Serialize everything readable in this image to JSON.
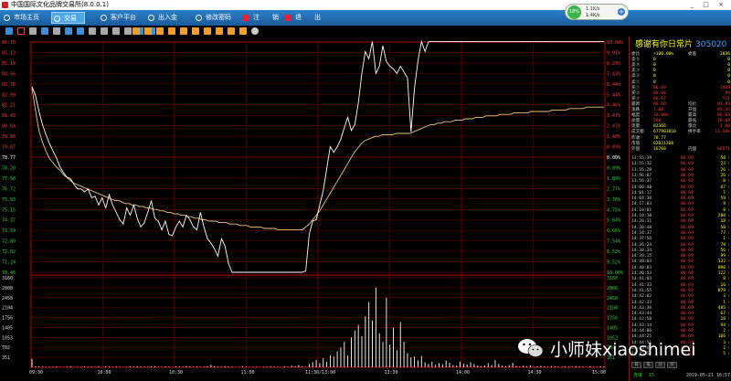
{
  "app": {
    "title": "中国国际文化品牌交易所(8.0.0.1)",
    "window_controls": "_ □ ×"
  },
  "menu": [
    {
      "label": "市场主页",
      "icon": "home-icon",
      "active": false
    },
    {
      "label": "交易",
      "icon": "trade-icon",
      "active": true
    },
    {
      "label": "客户平台",
      "icon": "customer-icon",
      "active": false
    },
    {
      "label": "出入金",
      "icon": "money-icon",
      "active": false
    },
    {
      "label": "修改密码",
      "icon": "key-icon",
      "active": false
    },
    {
      "label": "注　　销",
      "icon": "logout-icon",
      "active": false,
      "danger": true
    },
    {
      "label": "退　　出",
      "icon": "exit-icon",
      "active": false,
      "danger": true
    }
  ],
  "net": {
    "percent": "18%",
    "up": "1.1K/s",
    "down": "1.4K/s"
  },
  "toolbar_icons": [
    "chart-icon",
    "pen-icon",
    "print-icon",
    "save-icon",
    "copy-icon",
    "zoom-in-icon",
    "zoom-out-icon",
    "left-icon",
    "right-icon",
    "up-icon",
    "down-icon",
    "list-icon",
    "grid-icon",
    "k-icon",
    "f-icon",
    "b-icon",
    "s-icon",
    "m-icon",
    "n-icon",
    "t-icon",
    "x-icon",
    "y-icon",
    "z-icon",
    "gear-icon"
  ],
  "stock": {
    "name": "感谢有你日常片",
    "code": "305020"
  },
  "quote_rows": [
    {
      "l": "委比",
      "v": "+100.00%",
      "l2": "委差",
      "v2": "2036"
    },
    {
      "l": "卖⑤",
      "v": "0",
      "v2": "0"
    },
    {
      "l": "卖④",
      "v": "0",
      "v2": "0"
    },
    {
      "l": "卖③",
      "v": "0",
      "v2": "0"
    },
    {
      "l": "卖②",
      "v": "0",
      "v2": "0"
    },
    {
      "l": "卖①",
      "v": "0",
      "v2": "0"
    },
    {
      "l": "买①",
      "v": "86.69",
      "v2": "1409"
    },
    {
      "l": "买②",
      "v": "86.68",
      "v2": "99"
    },
    {
      "l": "买③",
      "v": "86.67",
      "v2": "511"
    },
    {
      "l": "最新",
      "v": "86.69",
      "l2": "均价",
      "v2": "81.93"
    },
    {
      "l": "涨跌",
      "v": "7.88",
      "l2": "开盘",
      "v2": "83.35"
    },
    {
      "l": "幅度",
      "v": "10.00%",
      "l2": "最高",
      "v2": "86.69"
    },
    {
      "l": "总量",
      "v": "590",
      "l2": "最低",
      "v2": "70.08"
    },
    {
      "l": "现量",
      "v": "82366",
      "l2": "量比",
      "v2": "1.00"
    },
    {
      "l": "成交额",
      "v": "677903810",
      "l2": "换手率",
      "v2": "11.50%"
    },
    {
      "l": "昨收",
      "v": "78.77",
      "v2": ""
    },
    {
      "l": "市值",
      "v": "62821260",
      "v2": ""
    },
    {
      "l": "外盘",
      "v": "16768",
      "l2": "内盘",
      "v2": "66571"
    }
  ],
  "ticks": [
    {
      "t": "13:55:39",
      "p": "86.69",
      "v": "58",
      "d": "↑"
    },
    {
      "t": "13:55:32",
      "p": "86.69",
      "v": "23",
      "d": "↑"
    },
    {
      "t": "13:55:28",
      "p": "86.69",
      "v": "26",
      "d": "↑"
    },
    {
      "t": "13:56:07",
      "p": "86.69",
      "v": "26",
      "d": "↑"
    },
    {
      "t": "13:56:37",
      "p": "86.69",
      "v": "8",
      "d": "↑"
    },
    {
      "t": "14:00:48",
      "p": "86.69",
      "v": "67",
      "d": "↑"
    },
    {
      "t": "14:01:17",
      "p": "86.69",
      "v": "1",
      "d": "↑"
    },
    {
      "t": "14:04:30",
      "p": "86.69",
      "v": "59",
      "d": "↑"
    },
    {
      "t": "14:17:03",
      "p": "86.69",
      "v": "9",
      "d": "↑"
    },
    {
      "t": "14:10:01",
      "p": "86.69",
      "v": "8",
      "d": "↑"
    },
    {
      "t": "14:10:10",
      "p": "86.69",
      "v": "288",
      "d": "↑"
    },
    {
      "t": "14:20:31",
      "p": "86.69",
      "v": "18",
      "d": "↑"
    },
    {
      "t": "14:30:48",
      "p": "86.69",
      "v": "50",
      "d": "↑"
    },
    {
      "t": "14:34:37",
      "p": "86.69",
      "v": "77",
      "d": "↑"
    },
    {
      "t": "14:37:56",
      "p": "86.69",
      "v": "1",
      "d": "↑"
    },
    {
      "t": "14:36:24",
      "p": "86.69",
      "v": "78",
      "d": "↑"
    },
    {
      "t": "14:38:34",
      "p": "86.69",
      "v": "56",
      "d": "↑"
    },
    {
      "t": "14:39:15",
      "p": "86.69",
      "v": "99",
      "d": "↑"
    },
    {
      "t": "14:40:03",
      "p": "86.69",
      "v": "132",
      "d": "↑"
    },
    {
      "t": "14:40:03",
      "p": "86.69",
      "v": "890",
      "d": "↑"
    },
    {
      "t": "14:40:53",
      "p": "86.69",
      "v": "122",
      "d": "↑"
    },
    {
      "t": "14:41:03",
      "p": "86.69",
      "v": "8",
      "d": "↑"
    },
    {
      "t": "14:41:33",
      "p": "86.69",
      "v": "16",
      "d": "↑"
    },
    {
      "t": "14:41:55",
      "p": "86.69",
      "v": "879",
      "d": "↑"
    },
    {
      "t": "14:42:02",
      "p": "86.69",
      "v": "3",
      "d": "↑"
    },
    {
      "t": "14:42:33",
      "p": "86.69",
      "v": "1",
      "d": "↑"
    },
    {
      "t": "14:43:36",
      "p": "86.69",
      "v": "485",
      "d": "↑"
    },
    {
      "t": "14:43:44",
      "p": "86.69",
      "v": "67",
      "d": "↑"
    },
    {
      "t": "14:43:58",
      "p": "86.69",
      "v": "18",
      "d": "↑"
    },
    {
      "t": "14:43:14",
      "p": "86.69",
      "v": "94",
      "d": "↑"
    },
    {
      "t": "14:44:06",
      "p": "86.69",
      "v": "2",
      "d": "↑"
    },
    {
      "t": "14:44:25",
      "p": "86.69",
      "v": "166",
      "d": "↑"
    },
    {
      "t": "14:44:51",
      "p": "86.69",
      "v": "3",
      "d": "↑"
    },
    {
      "t": "14:45:02",
      "p": "86.69",
      "v": "2",
      "d": "↑"
    },
    {
      "t": "14:45:53",
      "p": "86.69",
      "v": "5",
      "d": "↑"
    }
  ],
  "panel_tabs": [
    "日",
    "笔",
    "分",
    "价"
  ],
  "status": {
    "connected": "连接",
    "count": "15",
    "datetime": "2019-05-21 16:57"
  },
  "watermark": "小师妹xiaoshimei",
  "colors": {
    "up": "#ff3b3b",
    "down": "#33d633",
    "flat": "#ffffff",
    "grid": "#7a0000",
    "avg": "#e8c87a",
    "volume": "#ffffff"
  },
  "chart_data": {
    "type": "line",
    "title": "",
    "xlabel": "",
    "ylabel": "",
    "prev_close": 78.77,
    "ylim": [
      70.9,
      86.65
    ],
    "price_ticks": [
      "86.70",
      "85.13",
      "85.14",
      "84.56",
      "83.78",
      "82.99",
      "82.21",
      "81.43",
      "80.64",
      "79.86",
      "79.07",
      "78.77",
      "78.20",
      "77.50",
      "76.72",
      "75.93",
      "75.15",
      "74.37",
      "73.59",
      "72.80",
      "72.02",
      "71.24",
      "70.46"
    ],
    "pct_ticks": [
      "10.00%",
      "9.07%",
      "8.29%",
      "7.43%",
      "6.44%",
      "5.44%",
      "4.46%",
      "3.47%",
      "2.47%",
      "1.48%",
      "0.49%",
      "0.00%",
      "0.89%",
      "1.80%",
      "2.77%",
      "3.76%",
      "4.75%",
      "5.64%",
      "6.66%",
      "7.54%",
      "8.53%",
      "9.52%",
      "10.00%"
    ],
    "volume_ticks": [
      "3160",
      "2808",
      "2458",
      "2104",
      "1756",
      "1405",
      "1053",
      "702",
      "351"
    ],
    "time_labels": [
      "09:30",
      "10:00",
      "10:30",
      "11:00",
      "11:30/13:00",
      "13:30",
      "14:00",
      "14:30",
      "15:00"
    ],
    "series": [
      {
        "values": [
          83.6,
          83.0,
          81.9,
          81.0,
          80.3,
          79.7,
          79.2,
          78.7,
          78.1,
          77.7,
          77.4,
          77.3,
          76.9,
          76.6,
          76.6,
          76.4,
          76.6,
          76.0,
          76.1,
          75.5,
          76.0,
          75.3,
          76.2,
          75.5,
          75.0,
          74.5,
          74.2,
          75.3,
          74.8,
          75.5,
          74.6,
          74.0,
          74.3,
          75.0,
          75.8,
          74.6,
          74.4,
          73.8,
          74.4,
          73.5,
          73.4,
          74.0,
          74.4,
          74.0,
          74.8,
          74.5,
          74.0,
          73.8,
          75.0,
          74.0,
          73.2,
          72.9,
          72.5,
          72.0,
          73.2,
          72.7,
          71.5,
          70.9,
          70.9,
          70.9,
          70.9,
          70.9,
          70.9,
          70.9,
          70.9,
          70.9,
          70.9,
          70.9,
          70.9,
          70.9,
          70.9,
          70.9,
          70.9,
          70.9,
          70.9,
          70.9,
          70.9,
          70.9,
          71.0,
          73.5,
          74.4,
          74.5,
          75.5,
          76.5,
          78.0,
          79.5,
          79.1,
          79.5,
          80.0,
          80.8,
          81.5,
          80.6,
          81.0,
          82.5,
          84.5,
          86.0,
          85.5,
          86.69,
          84.5,
          85.0,
          86.4,
          85.3,
          85.0,
          84.8,
          84.5,
          85.0,
          84.6,
          84.2,
          80.5,
          83.5,
          85.4,
          86.69,
          86.0,
          86.69,
          86.69,
          86.69,
          86.69,
          86.69,
          86.69,
          86.69,
          86.69,
          86.69,
          86.69,
          86.69,
          86.69,
          86.69,
          86.69,
          86.69,
          86.69,
          86.69,
          86.69,
          86.69,
          86.69,
          86.69,
          86.69,
          86.69,
          86.69,
          86.69,
          86.69,
          86.69,
          86.69,
          86.69,
          86.69,
          86.69,
          86.69,
          86.69,
          86.69,
          86.69,
          86.69,
          86.69,
          86.69,
          86.69,
          86.69,
          86.69,
          86.69,
          86.69,
          86.69,
          86.69,
          86.69,
          86.69,
          86.69,
          86.69,
          86.69,
          86.69
        ]
      },
      {
        "values": [
          83.5,
          82.0,
          80.6,
          79.8,
          79.2,
          78.7,
          78.4,
          78.1,
          77.9,
          77.6,
          77.4,
          77.2,
          77.0,
          76.9,
          76.8,
          76.7,
          76.6,
          76.5,
          76.4,
          76.3,
          76.2,
          76.1,
          76.0,
          75.9,
          75.8,
          75.8,
          75.7,
          75.6,
          75.6,
          75.5,
          75.5,
          75.4,
          75.4,
          75.3,
          75.3,
          75.2,
          75.2,
          75.1,
          75.1,
          75.0,
          75.0,
          74.9,
          74.9,
          74.8,
          74.8,
          74.7,
          74.7,
          74.6,
          74.6,
          74.5,
          74.5,
          74.4,
          74.4,
          74.4,
          74.3,
          74.3,
          74.3,
          74.2,
          74.2,
          74.2,
          74.1,
          74.1,
          74.1,
          74.0,
          74.0,
          74.0,
          74.0,
          73.9,
          73.9,
          73.9,
          73.9,
          73.8,
          73.8,
          73.8,
          73.8,
          73.8,
          73.8,
          73.8,
          73.8,
          74.0,
          74.2,
          74.5,
          74.8,
          75.1,
          75.5,
          75.9,
          76.3,
          76.7,
          77.1,
          77.5,
          77.9,
          78.3,
          78.7,
          79.1,
          79.4,
          79.7,
          79.9,
          80.0,
          80.1,
          80.2,
          80.2,
          80.3,
          80.3,
          80.3,
          80.3,
          80.4,
          80.4,
          80.4,
          80.4,
          80.4,
          80.5,
          80.6,
          80.7,
          80.8,
          80.9,
          81.0,
          81.0,
          81.1,
          81.1,
          81.2,
          81.2,
          81.2,
          81.3,
          81.3,
          81.3,
          81.4,
          81.4,
          81.4,
          81.5,
          81.5,
          81.5,
          81.6,
          81.6,
          81.6,
          81.6,
          81.7,
          81.7,
          81.7,
          81.7,
          81.8,
          81.8,
          81.8,
          81.8,
          81.8,
          81.9,
          81.9,
          81.9,
          81.9,
          81.9,
          81.9,
          82.0,
          82.0,
          82.0,
          82.0,
          82.0,
          82.1,
          82.1,
          82.1,
          82.1,
          82.1,
          82.2,
          82.2,
          82.2,
          82.2,
          82.2,
          82.2
        ]
      }
    ],
    "volumes": [
      300,
      40,
      30,
      20,
      15,
      20,
      10,
      30,
      15,
      10,
      20,
      40,
      15,
      20,
      10,
      30,
      15,
      20,
      10,
      30,
      10,
      40,
      20,
      15,
      30,
      20,
      15,
      10,
      30,
      20,
      40,
      30,
      20,
      15,
      30,
      40,
      20,
      15,
      30,
      20,
      10,
      40,
      30,
      25,
      50,
      40,
      20,
      30,
      15,
      25,
      40,
      90,
      30,
      20,
      15,
      40,
      30,
      20,
      10,
      15,
      30,
      20,
      10,
      15,
      20,
      10,
      20,
      15,
      40,
      20,
      15,
      10,
      30,
      20,
      60,
      40,
      80,
      30,
      20,
      120,
      180,
      260,
      150,
      320,
      200,
      420,
      380,
      560,
      700,
      900,
      420,
      1050,
      1300,
      1500,
      1100,
      1800,
      2300,
      1650,
      2808,
      1200,
      900,
      2458,
      800,
      1400,
      600,
      1600,
      900,
      500,
      350,
      380,
      250,
      400,
      180,
      120,
      200,
      90,
      150,
      110,
      240,
      160,
      80,
      60,
      200,
      120,
      100,
      180,
      120,
      70,
      40,
      60,
      150,
      80,
      250,
      120,
      60,
      40,
      80,
      160,
      50,
      30,
      60,
      40,
      70,
      20,
      30,
      50,
      30,
      20,
      45,
      40,
      25,
      15,
      30,
      20,
      10,
      40,
      30,
      25,
      15,
      30,
      20,
      10,
      40,
      30
    ]
  }
}
